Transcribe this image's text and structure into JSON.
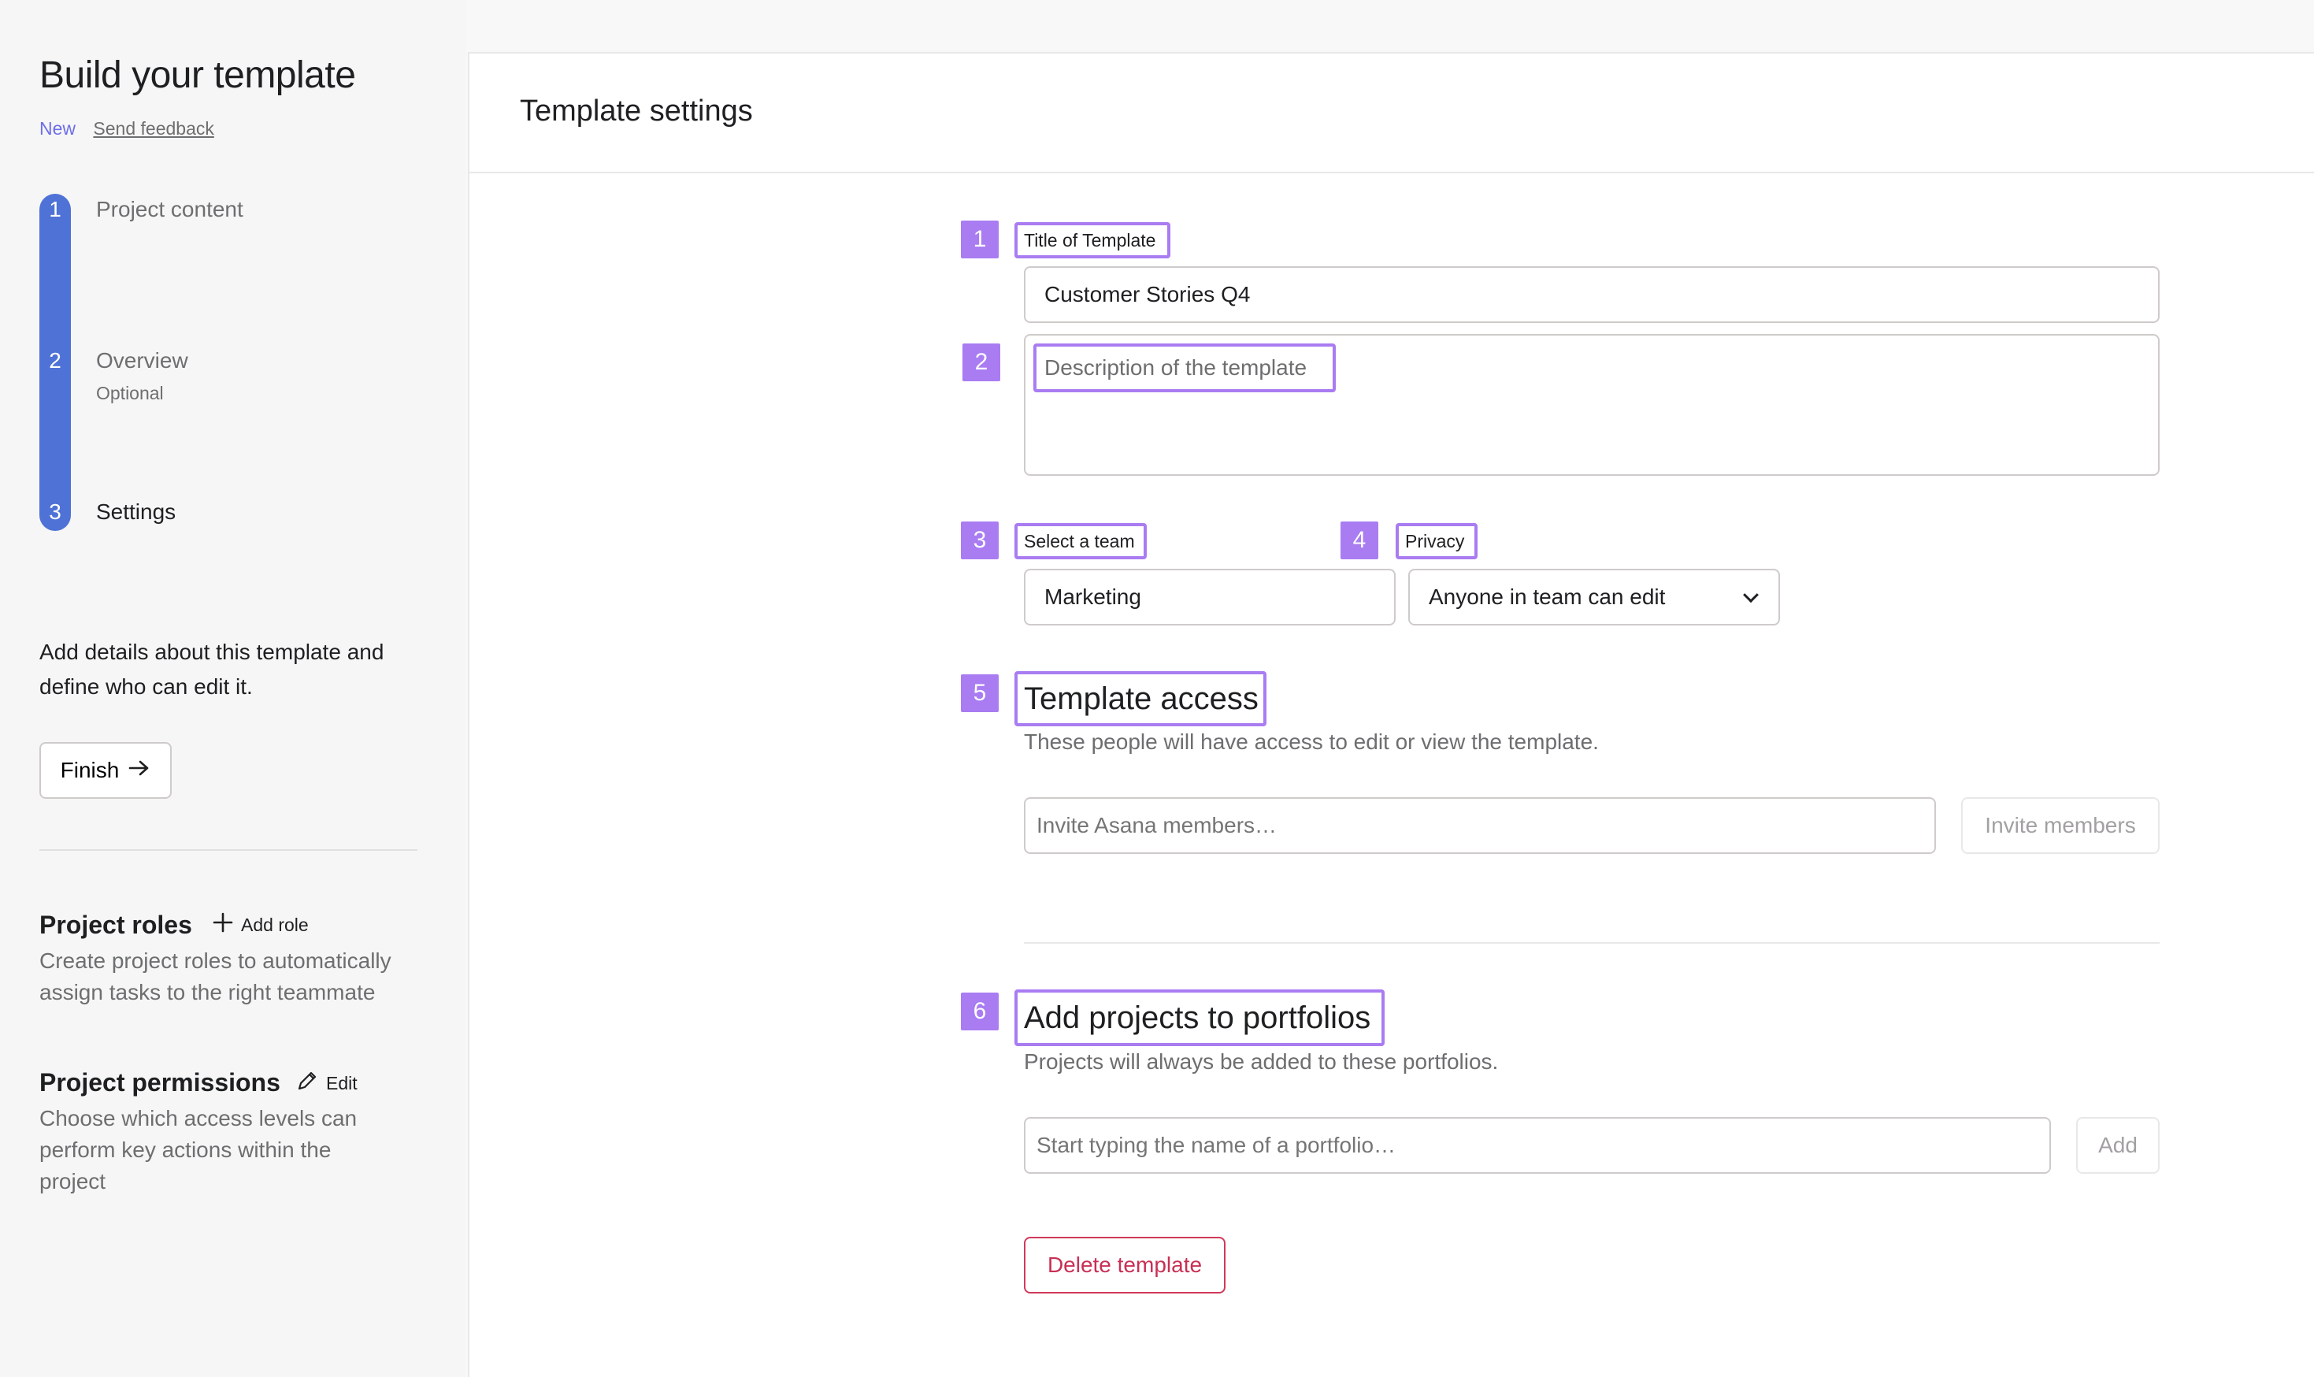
{
  "sidebar": {
    "title": "Build your template",
    "new_label": "New",
    "feedback_label": "Send feedback",
    "steps": [
      {
        "num": "1",
        "label": "Project content"
      },
      {
        "num": "2",
        "label": "Overview",
        "sub": "Optional"
      },
      {
        "num": "3",
        "label": "Settings"
      }
    ],
    "description": "Add details about this template and define who can edit it.",
    "finish_label": "Finish",
    "roles": {
      "title": "Project roles",
      "action": "Add role",
      "description": "Create project roles to automatically assign tasks to the right teammate"
    },
    "permissions": {
      "title": "Project permissions",
      "action": "Edit",
      "description": "Choose which access levels can perform key actions within the project"
    }
  },
  "main": {
    "title": "Template settings",
    "badges": [
      "1",
      "2",
      "3",
      "4",
      "5",
      "6"
    ],
    "title_field": {
      "label": "Title of Template",
      "value": "Customer Stories Q4"
    },
    "description_field": {
      "placeholder": "Description of the template"
    },
    "team_field": {
      "label": "Select a team",
      "value": "Marketing"
    },
    "privacy_field": {
      "label": "Privacy",
      "value": "Anyone in team can edit"
    },
    "access": {
      "heading": "Template access",
      "description": "These people will have access to edit or view the template.",
      "input_placeholder": "Invite Asana members…",
      "button": "Invite members"
    },
    "portfolios": {
      "heading": "Add projects to portfolios",
      "description": "Projects will always be added to these portfolios.",
      "input_placeholder": "Start typing the name of a portfolio…",
      "button": "Add"
    },
    "delete_label": "Delete template"
  },
  "colors": {
    "accent_purple": "#a97cf2",
    "stepper_blue": "#4f72d6",
    "danger": "#c92f54"
  }
}
